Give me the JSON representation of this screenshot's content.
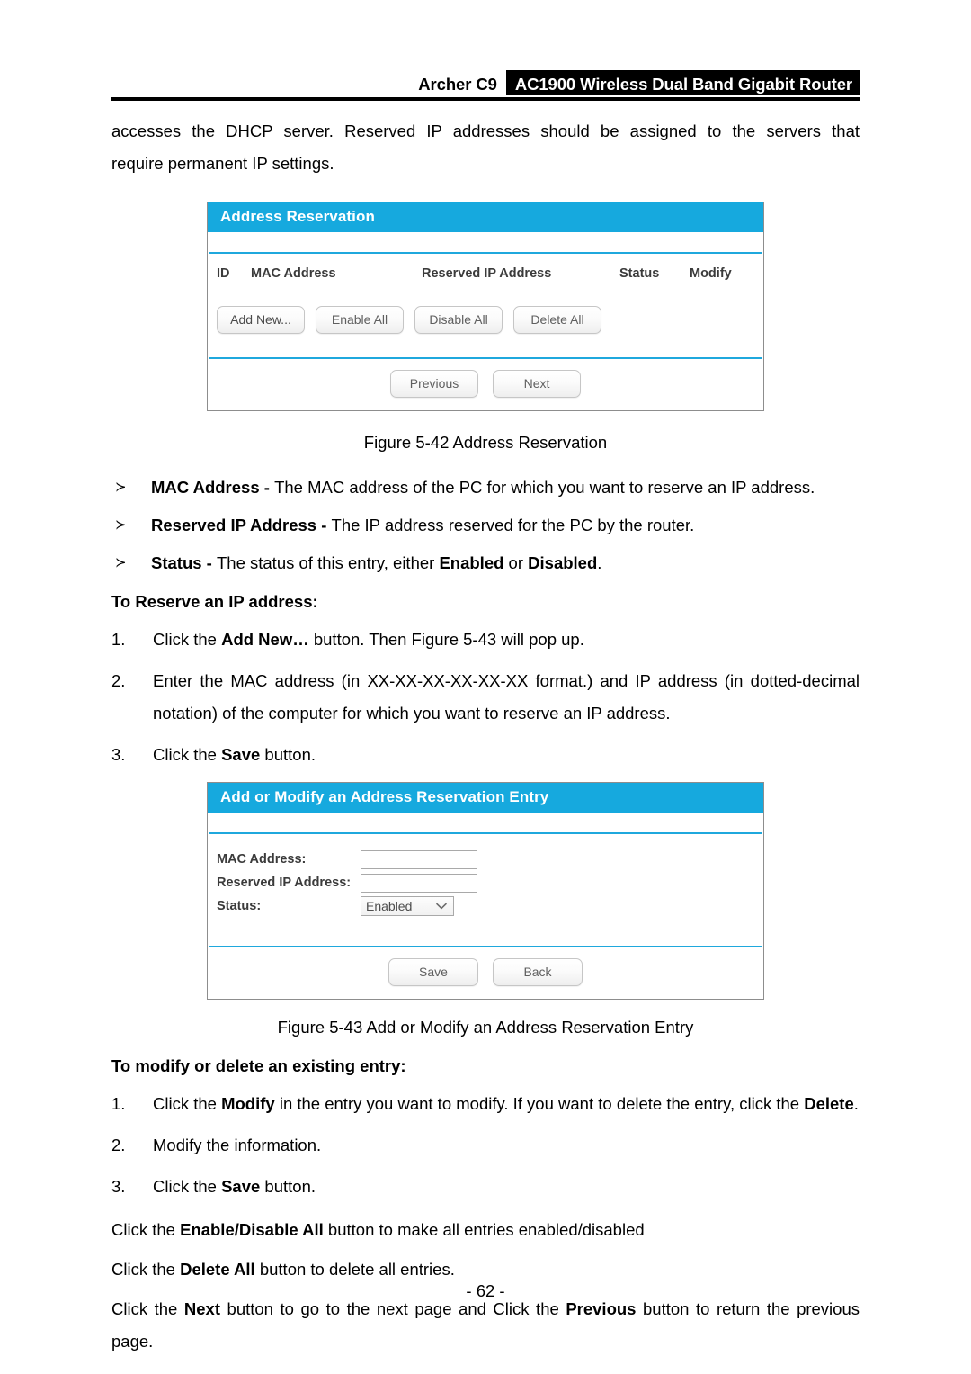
{
  "header": {
    "model": "Archer C9",
    "product": "AC1900 Wireless Dual Band Gigabit Router"
  },
  "intro": {
    "line1": "accesses the DHCP server. Reserved IP addresses should be assigned to the servers that",
    "line2": "require permanent IP settings."
  },
  "panel1": {
    "title": "Address Reservation",
    "columns": {
      "id": "ID",
      "mac": "MAC Address",
      "ip": "Reserved IP Address",
      "status": "Status",
      "modify": "Modify"
    },
    "buttons": {
      "add_new": "Add New...",
      "enable_all": "Enable All",
      "disable_all": "Disable All",
      "delete_all": "Delete All",
      "previous": "Previous",
      "next": "Next"
    }
  },
  "caption1": "Figure 5-42 Address Reservation",
  "bullets": [
    {
      "mark": "≻",
      "term": "MAC Address - ",
      "desc": "The MAC address of the PC for which you want to reserve an IP address."
    },
    {
      "mark": "≻",
      "term": "Reserved IP Address - ",
      "desc": "The IP address reserved for the PC by the router."
    },
    {
      "mark": "≻",
      "term": "Status - ",
      "desc_pre": "The status of this entry, either ",
      "bold1": "Enabled",
      "desc_mid": " or ",
      "bold2": "Disabled",
      "desc_post": "."
    }
  ],
  "section1": {
    "heading": "To Reserve an IP address:",
    "steps": [
      {
        "num": "1.",
        "pre": "Click the ",
        "bold": "Add New…",
        "post": " button. Then Figure 5-43 will pop up."
      },
      {
        "num": "2.",
        "pre": "Enter the MAC address (in XX-XX-XX-XX-XX-XX format.) and IP address (in dotted-decimal notation) of the computer for which you want to reserve an IP address.",
        "bold": "",
        "post": ""
      },
      {
        "num": "3.",
        "pre": "Click the ",
        "bold": "Save",
        "post": " button."
      }
    ]
  },
  "panel2": {
    "title": "Add or Modify an Address Reservation Entry",
    "fields": [
      {
        "label": "MAC Address:",
        "value": "",
        "type": "text"
      },
      {
        "label": "Reserved IP Address:",
        "value": "",
        "type": "text"
      },
      {
        "label": "Status:",
        "value": "Enabled",
        "type": "select"
      }
    ],
    "buttons": {
      "save": "Save",
      "back": "Back"
    }
  },
  "caption2": "Figure 5-43 Add or Modify an Address Reservation Entry",
  "section2": {
    "heading": "To modify or delete an existing entry:",
    "steps": [
      {
        "num": "1.",
        "pre": "Click the ",
        "bold": "Modify",
        "mid": " in the entry you want to modify. If you want to delete the entry, click the ",
        "bold2": "Delete",
        "post": "."
      },
      {
        "num": "2.",
        "pre": "Modify the information.",
        "bold": "",
        "post": ""
      },
      {
        "num": "3.",
        "pre": "Click the ",
        "bold": "Save",
        "post": " button."
      }
    ]
  },
  "closing": [
    {
      "pre": "Click the ",
      "bold": "Enable/Disable All",
      "post": " button to make all entries enabled/disabled"
    },
    {
      "pre": "Click the ",
      "bold": "Delete All",
      "post": " button to delete all entries."
    },
    {
      "pre": "Click the ",
      "bold": "Next",
      "mid": " button to go to the next page and Click the ",
      "bold2": "Previous",
      "post": " button to return the previous page."
    }
  ],
  "footer": {
    "page_number": "- 62 -"
  },
  "colors": {
    "panel_accent": "#16a9de",
    "panel_border": "#8d8d8d",
    "header_bar": "#000000"
  }
}
